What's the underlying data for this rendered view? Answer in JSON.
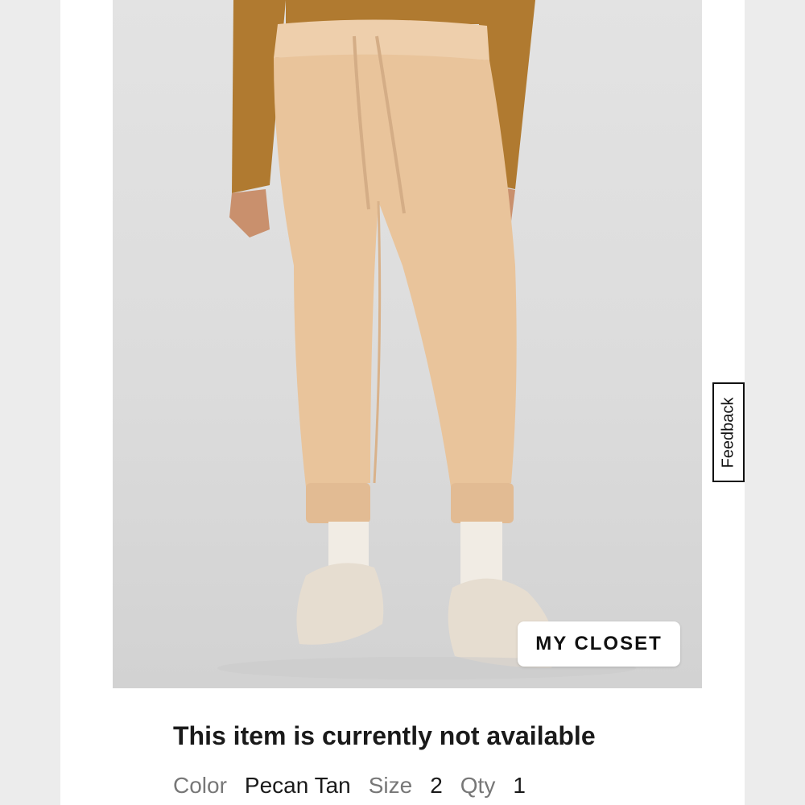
{
  "product": {
    "image_alt": "Pecan Tan jogger pants",
    "closet_button": "MY CLOSET",
    "status": "This item is currently not available",
    "details": {
      "color_label": "Color",
      "color_value": "Pecan Tan",
      "size_label": "Size",
      "size_value": "2",
      "qty_label": "Qty",
      "qty_value": "1"
    }
  },
  "feedback_tab": "Feedback",
  "colors": {
    "background": "#ffffff",
    "pant": "#e9c49b",
    "top": "#b07a30"
  }
}
